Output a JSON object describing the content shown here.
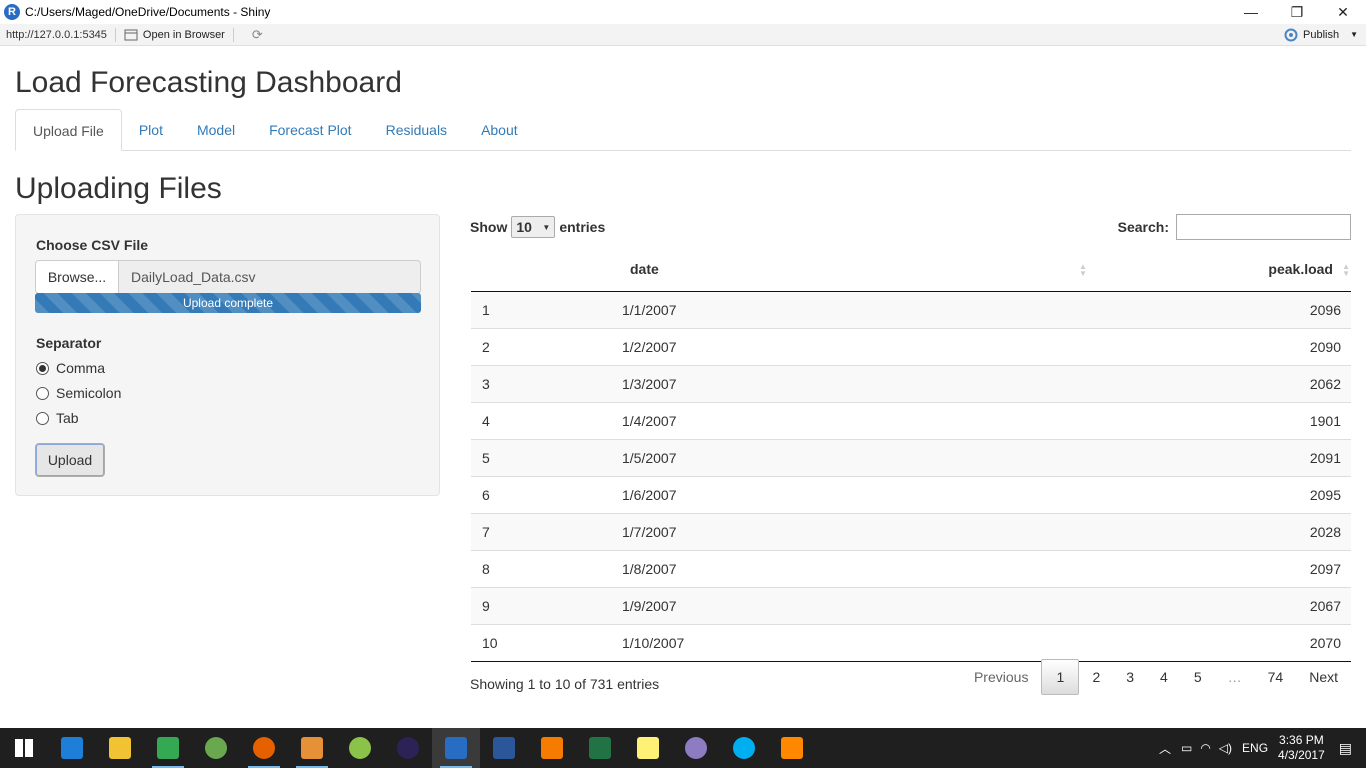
{
  "window": {
    "title": "C:/Users/Maged/OneDrive/Documents - Shiny",
    "minimize": "—",
    "restore": "❐",
    "close": "✕"
  },
  "address_bar": {
    "url": "http://127.0.0.1:5345",
    "open_in_browser": "Open in Browser",
    "publish": "Publish"
  },
  "app": {
    "title": "Load Forecasting Dashboard",
    "tabs": [
      {
        "label": "Upload File",
        "active": true
      },
      {
        "label": "Plot"
      },
      {
        "label": "Model"
      },
      {
        "label": "Forecast Plot"
      },
      {
        "label": "Residuals"
      },
      {
        "label": "About"
      }
    ],
    "section_title": "Uploading Files"
  },
  "sidebar": {
    "file_label": "Choose CSV File",
    "browse_label": "Browse...",
    "file_name": "DailyLoad_Data.csv",
    "progress_text": "Upload complete",
    "progress": 1.0,
    "separator_label": "Separator",
    "options": [
      {
        "label": "Comma",
        "selected": true
      },
      {
        "label": "Semicolon",
        "selected": false
      },
      {
        "label": "Tab",
        "selected": false
      }
    ],
    "upload_button": "Upload"
  },
  "table": {
    "show_label": "Show",
    "page_length": "10",
    "entries_label": "entries",
    "search_label": "Search:",
    "search_value": "",
    "columns": [
      "",
      "date",
      "peak.load"
    ],
    "rows": [
      [
        "1",
        "1/1/2007",
        "2096"
      ],
      [
        "2",
        "1/2/2007",
        "2090"
      ],
      [
        "3",
        "1/3/2007",
        "2062"
      ],
      [
        "4",
        "1/4/2007",
        "1901"
      ],
      [
        "5",
        "1/5/2007",
        "2091"
      ],
      [
        "6",
        "1/6/2007",
        "2095"
      ],
      [
        "7",
        "1/7/2007",
        "2028"
      ],
      [
        "8",
        "1/8/2007",
        "2097"
      ],
      [
        "9",
        "1/9/2007",
        "2067"
      ],
      [
        "10",
        "1/10/2007",
        "2070"
      ]
    ],
    "info": "Showing 1 to 10 of 731 entries",
    "pagination": {
      "previous": "Previous",
      "pages": [
        "1",
        "2",
        "3",
        "4",
        "5",
        "…",
        "74"
      ],
      "current": "1",
      "next": "Next"
    }
  },
  "taskbar": {
    "icons": [
      {
        "name": "start-icon",
        "color": "#ffffff"
      },
      {
        "name": "edge-icon",
        "color": "#1e7fd8"
      },
      {
        "name": "file-explorer-icon",
        "color": "#f1c232"
      },
      {
        "name": "google-drive-icon",
        "color": "#34a853"
      },
      {
        "name": "globe-icon",
        "color": "#6aa84f"
      },
      {
        "name": "firefox-icon",
        "color": "#e66000"
      },
      {
        "name": "media-player-icon",
        "color": "#e69138"
      },
      {
        "name": "downloader-icon",
        "color": "#8bc34a"
      },
      {
        "name": "eclipse-icon",
        "color": "#2c2255"
      },
      {
        "name": "rstudio-icon",
        "color": "#276dc3"
      },
      {
        "name": "word-icon",
        "color": "#2b579a"
      },
      {
        "name": "pdf-icon",
        "color": "#f57c00"
      },
      {
        "name": "excel-icon",
        "color": "#217346"
      },
      {
        "name": "sticky-notes-icon",
        "color": "#fff176"
      },
      {
        "name": "torrent-icon",
        "color": "#8e7cc3"
      },
      {
        "name": "skype-icon",
        "color": "#00aff0"
      },
      {
        "name": "vlc-icon",
        "color": "#ff8800"
      }
    ],
    "language": "ENG",
    "time": "3:36 PM",
    "date": "4/3/2017"
  }
}
